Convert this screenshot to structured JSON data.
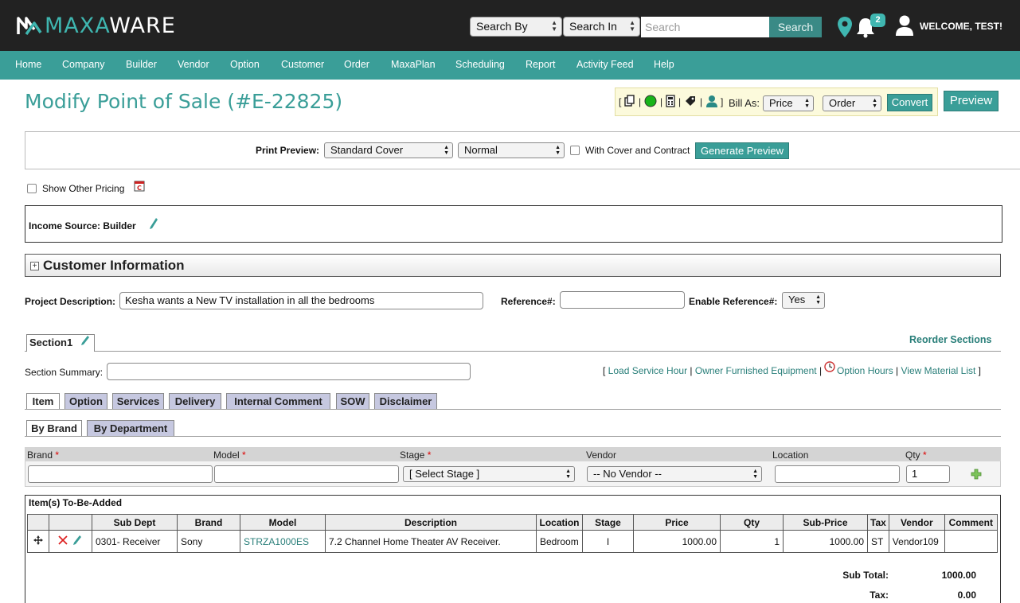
{
  "header": {
    "logo_left": "MAXA",
    "logo_right": "WARE",
    "search_by": "Search By",
    "search_in": "Search In",
    "search_placeholder": "Search",
    "search_button": "Search",
    "notification_count": "2",
    "welcome": "WELCOME, TEST!",
    "icons": [
      "location-pin-icon",
      "bell-icon",
      "user-icon"
    ]
  },
  "nav": {
    "items": [
      "Home",
      "Company",
      "Builder",
      "Vendor",
      "Option",
      "Customer",
      "Order",
      "MaxaPlan",
      "Scheduling",
      "Report",
      "Activity Feed",
      "Help"
    ]
  },
  "page": {
    "title": "Modify Point of Sale (#E-22825)",
    "bill_as_label": "Bill As:",
    "bill_as_value": "Price",
    "order_value": "Order",
    "convert_button": "Convert",
    "preview_button": "Preview",
    "toolbar_icons": [
      "copy-icon",
      "green-status-icon",
      "calculator-icon",
      "tag-icon",
      "person-icon"
    ]
  },
  "print_preview": {
    "label": "Print Preview:",
    "cover_value": "Standard Cover",
    "mode_value": "Normal",
    "with_cover_label": "With Cover and Contract",
    "generate_button": "Generate Preview"
  },
  "show_other_pricing": "Show Other Pricing",
  "income_source": "Income Source: Builder",
  "customer_info_title": "Customer Information",
  "project": {
    "description_label": "Project Description:",
    "description_value": "Kesha wants a New TV installation in all the bedrooms",
    "reference_label": "Reference#:",
    "reference_value": "",
    "enable_reference_label": "Enable Reference#:",
    "enable_reference_value": "Yes"
  },
  "section": {
    "tab_label": "Section1",
    "reorder_link": "Reorder Sections",
    "summary_label": "Section Summary:",
    "links": [
      "Load Service Hour",
      "Owner Furnished Equipment",
      "Option Hours",
      "View Material List"
    ]
  },
  "item_tabs": [
    "Item",
    "Option",
    "Services",
    "Delivery",
    "Internal Comment",
    "SOW",
    "Disclaimer"
  ],
  "sub_tabs": [
    "By Brand",
    "By Department"
  ],
  "entry": {
    "headers": [
      "Brand",
      "Model",
      "Stage",
      "Vendor",
      "Location",
      "Qty"
    ],
    "required": [
      true,
      true,
      true,
      false,
      false,
      true
    ],
    "stage_value": "[ Select Stage ]",
    "vendor_value": "-- No Vendor --",
    "qty_value": "1"
  },
  "items": {
    "title": "Item(s) To-Be-Added",
    "columns": [
      "",
      "",
      "Sub Dept",
      "Brand",
      "Model",
      "Description",
      "Location",
      "Stage",
      "Price",
      "Qty",
      "Sub-Price",
      "Tax",
      "Vendor",
      "Comment"
    ],
    "rows": [
      {
        "sub_dept": "0301- Receiver",
        "brand": "Sony",
        "model": "STRZA1000ES",
        "description": "7.2 Channel Home Theater AV Receiver.",
        "location": "Bedroom",
        "stage": "I",
        "price": "1000.00",
        "qty": "1",
        "sub_price": "1000.00",
        "tax": "ST",
        "vendor": "Vendor109",
        "comment": ""
      }
    ],
    "sub_total_label": "Sub Total:",
    "sub_total_value": "1000.00",
    "tax_label": "Tax:",
    "tax_value": "0.00"
  },
  "colors": {
    "brand_teal": "#3a9e98",
    "header_bg": "#222222",
    "link": "#2a7f7a",
    "tab_inactive": "#c6c8e0"
  }
}
